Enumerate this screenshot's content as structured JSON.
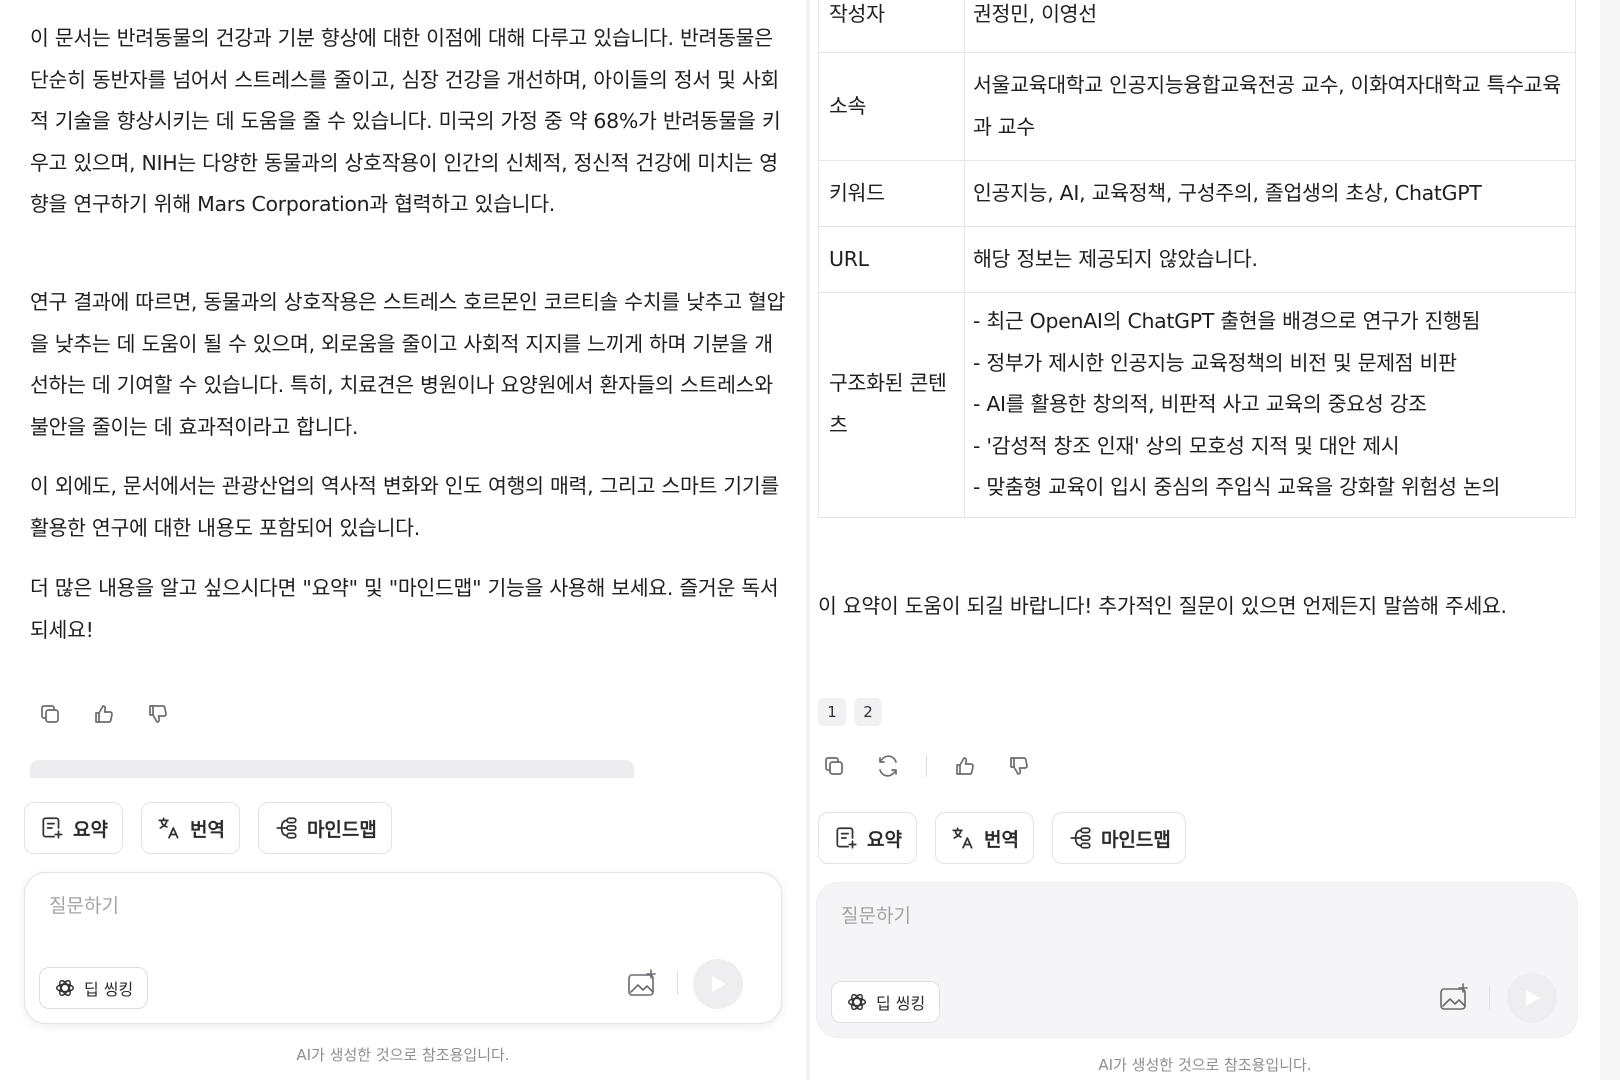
{
  "left": {
    "paragraphs": [
      "이 문서는 반려동물의 건강과 기분 향상에 대한 이점에 대해 다루고 있습니다. 반려동물은 단순히 동반자를 넘어서 스트레스를 줄이고, 심장 건강을 개선하며, 아이들의 정서 및 사회적 기술을 향상시키는 데 도움을 줄 수 있습니다. 미국의 가정 중 약 68%가 반려동물을 키우고 있으며, NIH는 다양한 동물과의 상호작용이 인간의 신체적, 정신적 건강에 미치는 영향을 연구하기 위해 Mars Corporation과 협력하고 있습니다.",
      "연구 결과에 따르면, 동물과의 상호작용은 스트레스 호르몬인 코르티솔 수치를 낮추고 혈압을 낮추는 데 도움이 될 수 있으며, 외로움을 줄이고 사회적 지지를 느끼게 하며 기분을 개선하는 데 기여할 수 있습니다. 특히, 치료견은 병원이나 요양원에서 환자들의 스트레스와 불안을 줄이는 데 효과적이라고 합니다.",
      "이 외에도, 문서에서는 관광산업의 역사적 변화와 인도 여행의 매력, 그리고 스마트 기기를 활용한 연구에 대한 내용도 포함되어 있습니다.",
      "더 많은 내용을 알고 싶으시다면 \"요약\" 및 \"마인드맵\" 기능을 사용해 보세요. 즐거운 독서 되세요!"
    ],
    "actions": {
      "summary": "요약",
      "translate": "번역",
      "mindmap": "마인드맵"
    },
    "ask": {
      "placeholder": "질문하기",
      "deep_thinking": "딥 씽킹"
    },
    "disclaimer": "AI가 생성한 것으로 참조용입니다."
  },
  "right": {
    "table": [
      {
        "key": "작성자",
        "value": [
          "권정민, 이영선"
        ]
      },
      {
        "key": "소속",
        "value": [
          "서울교육대학교 인공지능융합교육전공 교수, 이화여자대학교 특수교육과 교수"
        ]
      },
      {
        "key": "키워드",
        "value": [
          "인공지능, AI, 교육정책, 구성주의, 졸업생의 초상, ChatGPT"
        ]
      },
      {
        "key": "URL",
        "value": [
          "해당 정보는 제공되지 않았습니다."
        ]
      },
      {
        "key": "구조화된 콘텐츠",
        "value": [
          "- 최근 OpenAI의 ChatGPT 출현을 배경으로 연구가 진행됨",
          "- 정부가 제시한 인공지능 교육정책의 비전 및 문제점 비판",
          "- AI를 활용한 창의적, 비판적 사고 교육의 중요성 강조",
          "- '감성적 창조 인재' 상의 모호성 지적 및 대안 제시",
          "- 맞춤형 교육이 입시 중심의 주입식 교육을 강화할 위험성 논의"
        ]
      }
    ],
    "closing": "이 요약이 도움이 되길 바랍니다! 추가적인 질문이 있으면 언제든지 말씀해 주세요.",
    "pages": [
      "1",
      "2"
    ],
    "actions": {
      "summary": "요약",
      "translate": "번역",
      "mindmap": "마인드맵"
    },
    "ask": {
      "placeholder": "질문하기",
      "deep_thinking": "딥 씽킹"
    },
    "disclaimer": "AI가 생성한 것으로 참조용입니다."
  },
  "icons": {
    "copy": "copy-icon",
    "regenerate": "refresh-icon",
    "like": "thumbs-up-icon",
    "dislike": "thumbs-down-icon",
    "summary": "summary-doc-icon",
    "translate": "translate-icon",
    "mindmap": "mindmap-icon",
    "deep_thinking": "atom-icon",
    "image": "image-add-icon",
    "send": "send-icon"
  }
}
